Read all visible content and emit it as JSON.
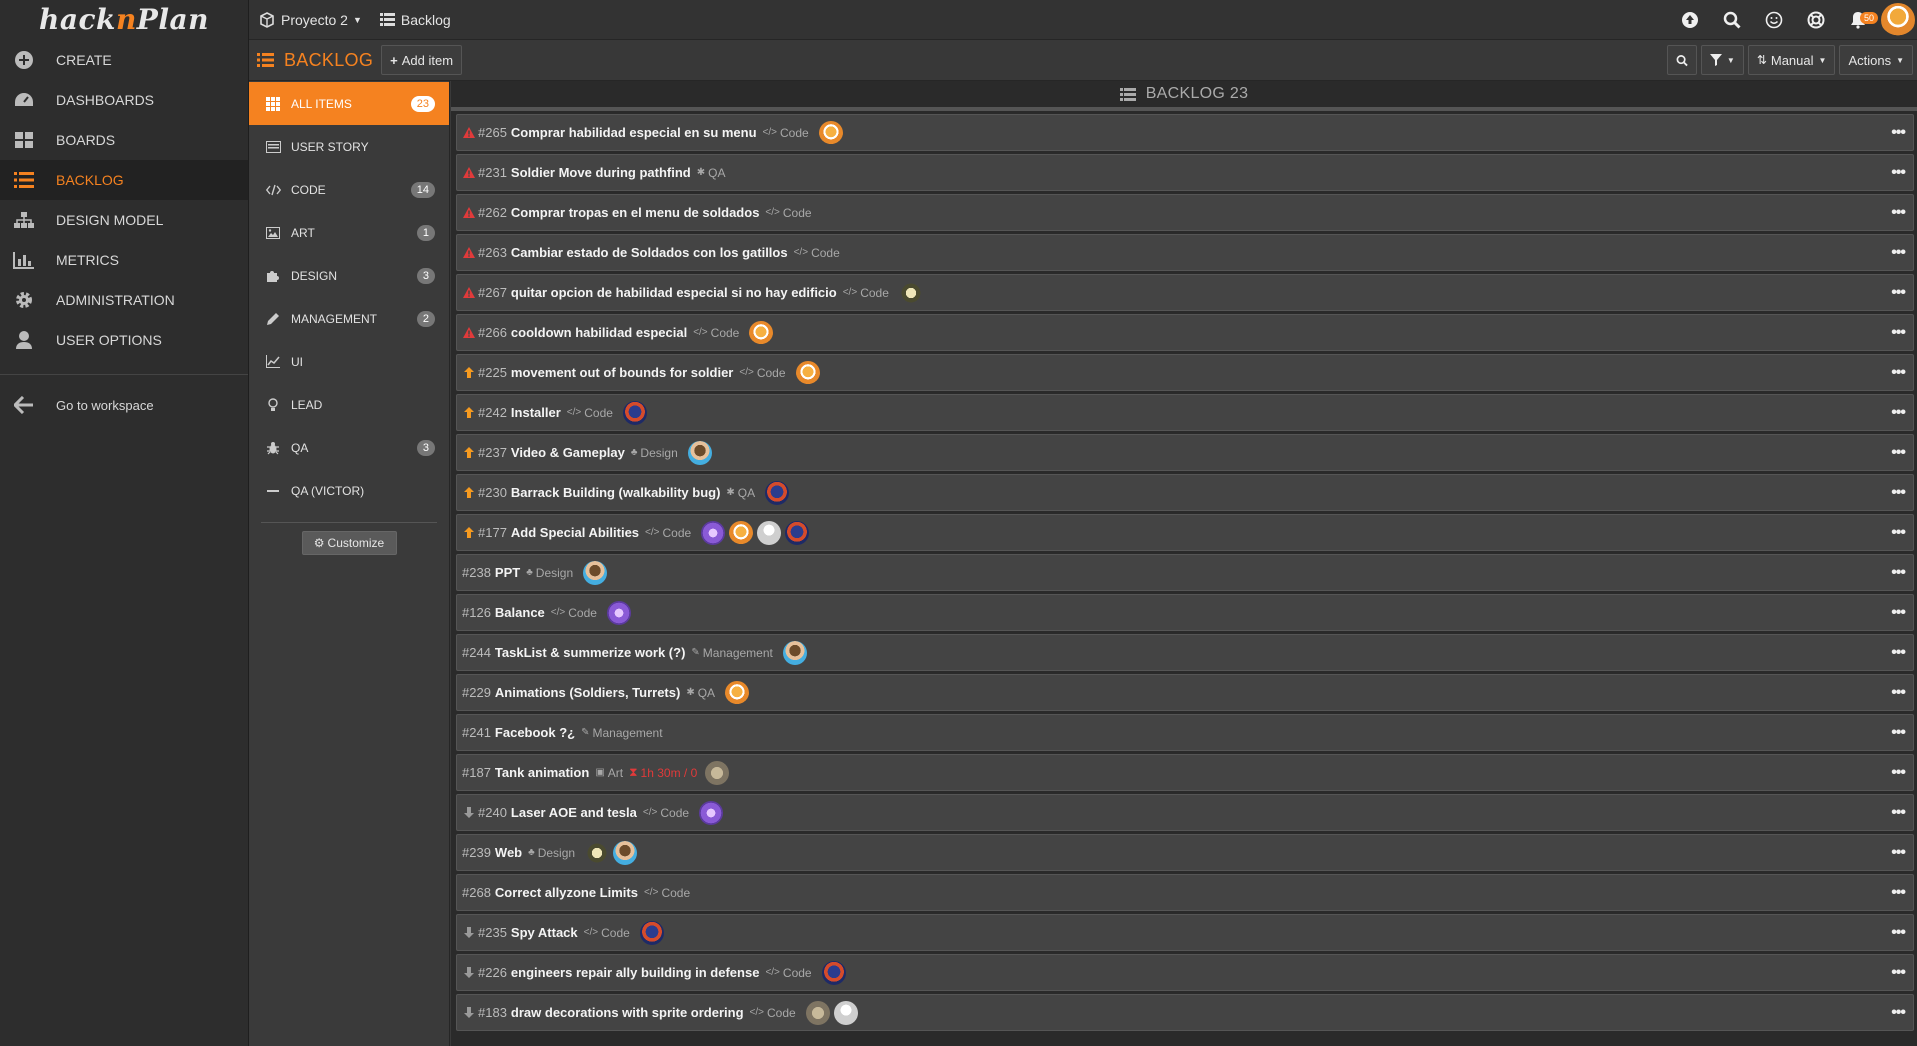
{
  "app": {
    "logo_pre": "hack",
    "logo_n": "n",
    "logo_post": "Plan"
  },
  "sidebar": {
    "items": [
      {
        "label": "CREATE",
        "icon": "plus-circle-icon"
      },
      {
        "label": "DASHBOARDS",
        "icon": "dashboard-icon"
      },
      {
        "label": "BOARDS",
        "icon": "boards-icon"
      },
      {
        "label": "BACKLOG",
        "icon": "list-icon",
        "active": true
      },
      {
        "label": "DESIGN MODEL",
        "icon": "sitemap-icon"
      },
      {
        "label": "METRICS",
        "icon": "bar-chart-icon"
      },
      {
        "label": "ADMINISTRATION",
        "icon": "gear-icon"
      },
      {
        "label": "USER OPTIONS",
        "icon": "user-icon"
      }
    ],
    "workspace_link": "Go to workspace"
  },
  "topbar": {
    "project": "Proyecto 2",
    "section": "Backlog",
    "notification_count": "50"
  },
  "subbar": {
    "title": "BACKLOG",
    "add_item": "Add item",
    "sort_label": "Manual",
    "actions_label": "Actions"
  },
  "categories": [
    {
      "label": "ALL ITEMS",
      "count": "23",
      "active": true,
      "icon": "grid-icon"
    },
    {
      "label": "USER STORY",
      "count": "",
      "icon": "card-icon"
    },
    {
      "label": "CODE",
      "count": "14",
      "icon": "code-icon"
    },
    {
      "label": "ART",
      "count": "1",
      "icon": "image-icon"
    },
    {
      "label": "DESIGN",
      "count": "3",
      "icon": "puzzle-icon"
    },
    {
      "label": "MANAGEMENT",
      "count": "2",
      "icon": "pencil-icon"
    },
    {
      "label": "UI",
      "count": "",
      "icon": "line-chart-icon"
    },
    {
      "label": "LEAD",
      "count": "",
      "icon": "lightbulb-icon"
    },
    {
      "label": "QA",
      "count": "3",
      "icon": "bug-icon"
    },
    {
      "label": "QA (VICTOR)",
      "count": "",
      "icon": "minus-icon"
    }
  ],
  "customize_label": "Customize",
  "list": {
    "header_label": "BACKLOG",
    "header_count": "23",
    "items": [
      {
        "id": "#265",
        "title": "Comprar habilidad especial en su menu",
        "category": "Code",
        "priority": "urgent",
        "avatars": [
          "tails"
        ]
      },
      {
        "id": "#231",
        "title": "Soldier Move during pathfind",
        "category": "QA",
        "priority": "urgent",
        "avatars": []
      },
      {
        "id": "#262",
        "title": "Comprar tropas en el menu de soldados",
        "category": "Code",
        "priority": "urgent",
        "avatars": []
      },
      {
        "id": "#263",
        "title": "Cambiar estado de Soldados con los gatillos",
        "category": "Code",
        "priority": "urgent",
        "avatars": []
      },
      {
        "id": "#267",
        "title": "quitar opcion de habilidad especial si no hay edificio",
        "category": "Code",
        "priority": "urgent",
        "avatars": [
          "bird"
        ]
      },
      {
        "id": "#266",
        "title": "cooldown habilidad especial",
        "category": "Code",
        "priority": "urgent",
        "avatars": [
          "tails"
        ]
      },
      {
        "id": "#225",
        "title": "movement out of bounds for soldier",
        "category": "Code",
        "priority": "high",
        "avatars": [
          "tails"
        ]
      },
      {
        "id": "#242",
        "title": "Installer",
        "category": "Code",
        "priority": "high",
        "avatars": [
          "blue"
        ]
      },
      {
        "id": "#237",
        "title": "Video & Gameplay",
        "category": "Design",
        "priority": "high",
        "avatars": [
          "boy"
        ]
      },
      {
        "id": "#230",
        "title": "Barrack Building (walkability bug)",
        "category": "QA",
        "priority": "high",
        "avatars": [
          "blue"
        ]
      },
      {
        "id": "#177",
        "title": "Add Special Abilities",
        "category": "Code",
        "priority": "high",
        "avatars": [
          "gem",
          "tails",
          "gray",
          "blue"
        ]
      },
      {
        "id": "#238",
        "title": "PPT",
        "category": "Design",
        "priority": "none",
        "avatars": [
          "boy"
        ]
      },
      {
        "id": "#126",
        "title": "Balance",
        "category": "Code",
        "priority": "none",
        "avatars": [
          "gem"
        ]
      },
      {
        "id": "#244",
        "title": "TaskList & summerize work (?)",
        "category": "Management",
        "priority": "none",
        "avatars": [
          "boy"
        ]
      },
      {
        "id": "#229",
        "title": "Animations (Soldiers, Turrets)",
        "category": "QA",
        "priority": "none",
        "avatars": [
          "tails"
        ]
      },
      {
        "id": "#241",
        "title": "Facebook ?¿",
        "category": "Management",
        "priority": "none",
        "avatars": []
      },
      {
        "id": "#187",
        "title": "Tank animation",
        "category": "Art",
        "priority": "none",
        "time": "1h 30m / 0",
        "avatars": [
          "tank"
        ]
      },
      {
        "id": "#240",
        "title": "Laser AOE and tesla",
        "category": "Code",
        "priority": "low",
        "avatars": [
          "gem"
        ]
      },
      {
        "id": "#239",
        "title": "Web",
        "category": "Design",
        "priority": "none",
        "avatars": [
          "bird",
          "boy"
        ]
      },
      {
        "id": "#268",
        "title": "Correct allyzone Limits",
        "category": "Code",
        "priority": "none",
        "avatars": []
      },
      {
        "id": "#235",
        "title": "Spy Attack",
        "category": "Code",
        "priority": "low",
        "avatars": [
          "blue"
        ]
      },
      {
        "id": "#226",
        "title": "engineers repair ally building in defense",
        "category": "Code",
        "priority": "low",
        "avatars": [
          "blue"
        ]
      },
      {
        "id": "#183",
        "title": "draw decorations with sprite ordering",
        "category": "Code",
        "priority": "low",
        "avatars": [
          "tank",
          "gray"
        ]
      }
    ]
  },
  "colors": {
    "accent": "#f58220",
    "urgent": "#e03a3a",
    "high": "#f59a20",
    "low": "#9a9a9a"
  }
}
